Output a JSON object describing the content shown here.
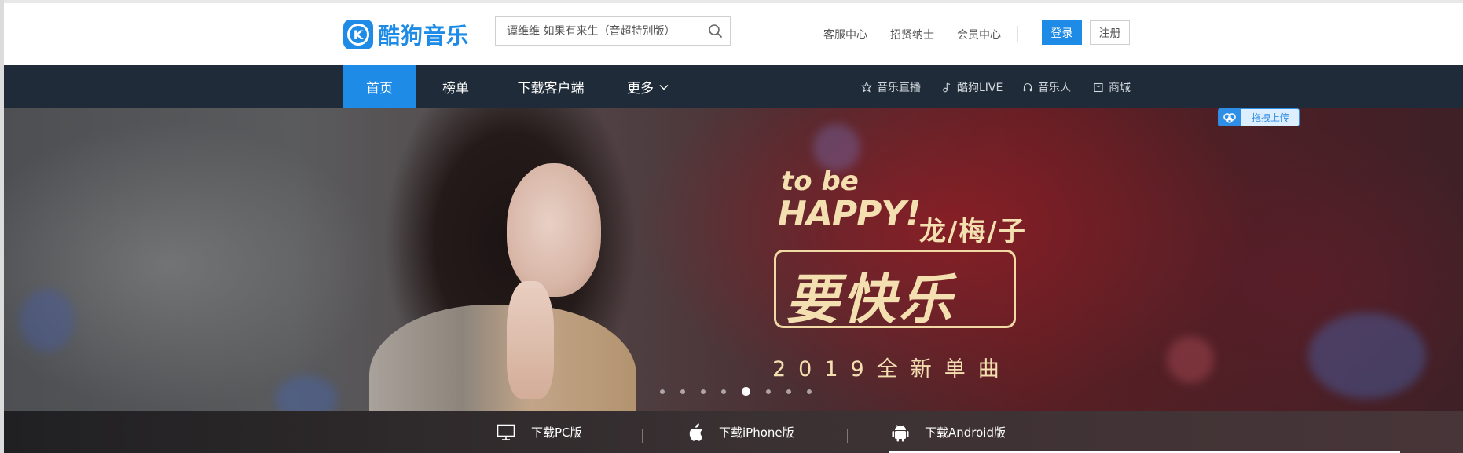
{
  "logo": {
    "badge_letter": "K",
    "text": "酷狗音乐",
    "icon": "kugou-logo-icon"
  },
  "search": {
    "placeholder": "谭维维 如果有来生（音超特别版）",
    "icon": "search-icon"
  },
  "header_links": [
    "客服中心",
    "招贤纳士",
    "会员中心"
  ],
  "auth": {
    "login": "登录",
    "register": "注册"
  },
  "nav": {
    "tabs": [
      {
        "label": "首页",
        "active": true
      },
      {
        "label": "榜单",
        "active": false
      },
      {
        "label": "下载客户端",
        "active": false
      },
      {
        "label": "更多",
        "active": false,
        "icon": "chevron-down-icon"
      }
    ],
    "right_links": [
      {
        "label": "音乐直播",
        "icon": "star-icon"
      },
      {
        "label": "酷狗LIVE",
        "icon": "music-note-icon"
      },
      {
        "label": "音乐人",
        "icon": "headphones-icon"
      },
      {
        "label": "商城",
        "icon": "shop-icon"
      }
    ]
  },
  "upload_tag": {
    "label": "拖拽上传",
    "icon": "cloud-upload-icon"
  },
  "banner": {
    "line_tobe": "to be",
    "line_happy": "HAPPY!",
    "artist": "龙/梅/子",
    "title": "要快乐",
    "subtitle": "2019全新单曲",
    "dot_count": 8,
    "active_dot": 5
  },
  "downloads": [
    {
      "label": "下载PC版",
      "icon": "monitor-icon"
    },
    {
      "label": "下载iPhone版",
      "icon": "apple-icon"
    },
    {
      "label": "下载Android版",
      "icon": "android-icon"
    }
  ],
  "colors": {
    "brand": "#1e8be6",
    "nav_bg": "#1f2b38",
    "promo_gold": "#f3dfb0"
  }
}
